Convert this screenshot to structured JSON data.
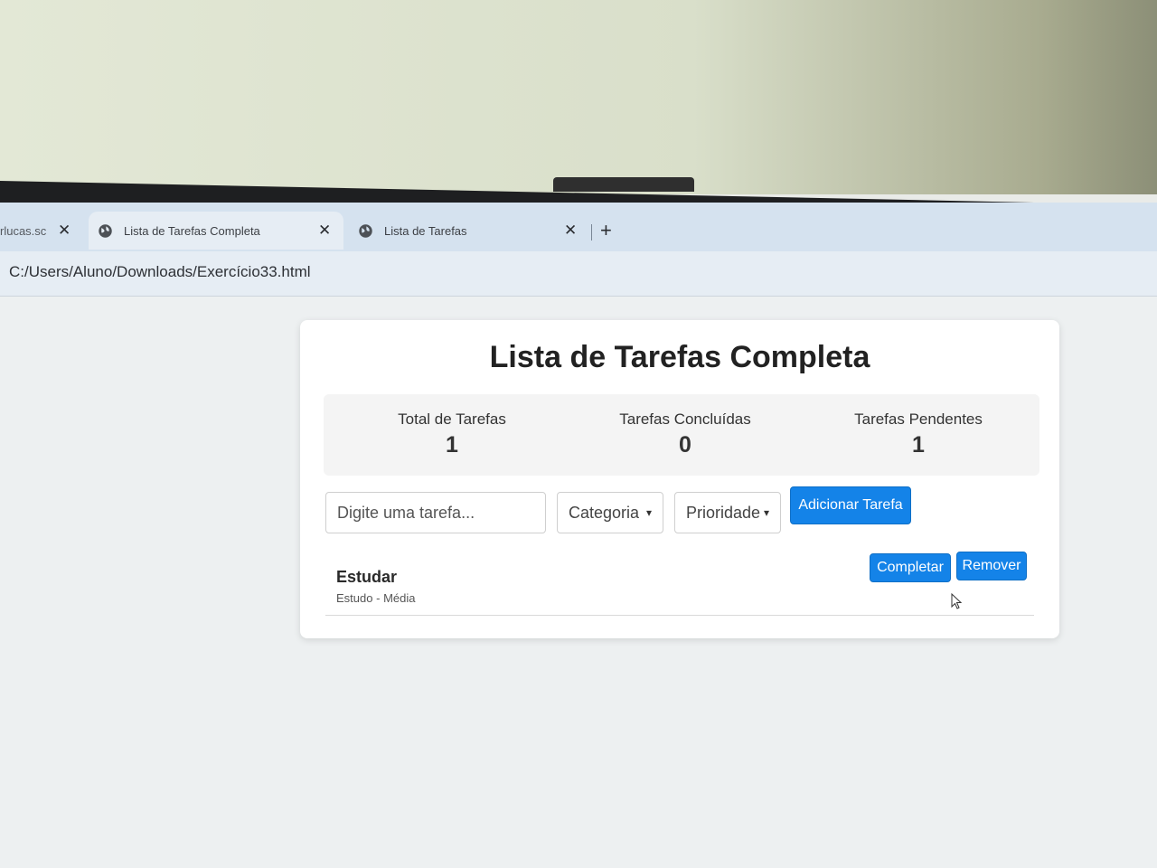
{
  "browser": {
    "tabs": [
      {
        "title": "rlucas.sc",
        "active": false
      },
      {
        "title": "Lista de Tarefas Completa",
        "active": true
      },
      {
        "title": "Lista de Tarefas",
        "active": false
      }
    ],
    "new_tab_icon": "plus-icon",
    "address": "C:/Users/Aluno/Downloads/Exercício33.html"
  },
  "app": {
    "title": "Lista de Tarefas Completa",
    "stats": {
      "total_label": "Total de Tarefas",
      "total_value": "1",
      "done_label": "Tarefas Concluídas",
      "done_value": "0",
      "pending_label": "Tarefas Pendentes",
      "pending_value": "1"
    },
    "form": {
      "task_placeholder": "Digite uma tarefa...",
      "category_value": "Categoria",
      "priority_value": "Prioridade",
      "add_label": "Adicionar Tarefa"
    },
    "tasks": [
      {
        "name": "Estudar",
        "category": "Estudo",
        "separator": "-",
        "priority": "Média",
        "complete_label": "Completar",
        "remove_label": "Remover"
      }
    ]
  },
  "colors": {
    "primary_button": "#1483e8",
    "tab_strip": "#d5e2ef"
  }
}
